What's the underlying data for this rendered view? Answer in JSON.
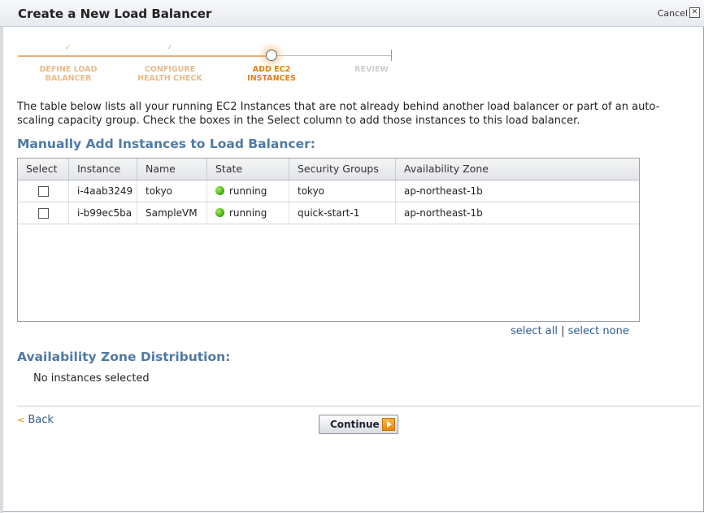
{
  "window": {
    "title": "Create a New Load Balancer",
    "cancel_label": "Cancel",
    "close_glyph": "✕"
  },
  "wizard": {
    "steps": [
      {
        "label": "DEFINE LOAD\nBALANCER",
        "state": "done"
      },
      {
        "label": "CONFIGURE\nHEALTH CHECK",
        "state": "done"
      },
      {
        "label": "ADD EC2\nINSTANCES",
        "state": "active"
      },
      {
        "label": "REVIEW",
        "state": "todo"
      }
    ],
    "check_glyph": "✓"
  },
  "intro": "The table below lists all your running EC2 Instances that are not already behind another load balancer or part of an auto-scaling capacity group. Check the boxes in the Select column to add those instances to this load balancer.",
  "manual_section": {
    "title": "Manually Add Instances to Load Balancer:",
    "columns": [
      "Select",
      "Instance",
      "Name",
      "State",
      "Security Groups",
      "Availability Zone"
    ],
    "rows": [
      {
        "instance": "i-4aab3249",
        "name": "tokyo",
        "state": "running",
        "security_group": "tokyo",
        "zone": "ap-northeast-1b"
      },
      {
        "instance": "i-b99ec5ba",
        "name": "SampleVM",
        "state": "running",
        "security_group": "quick-start-1",
        "zone": "ap-northeast-1b"
      }
    ],
    "select_all": "select all",
    "separator": "|",
    "select_none": "select none"
  },
  "az_section": {
    "title": "Availability Zone Distribution:",
    "empty_text": "No instances selected"
  },
  "footer": {
    "back_glyph": "<",
    "back_label": "Back",
    "continue_label": "Continue"
  },
  "colors": {
    "accent_orange": "#e47f14",
    "section_blue": "#4f7aa5",
    "link_blue": "#2c5c92",
    "running_green": "#3aa70d"
  }
}
